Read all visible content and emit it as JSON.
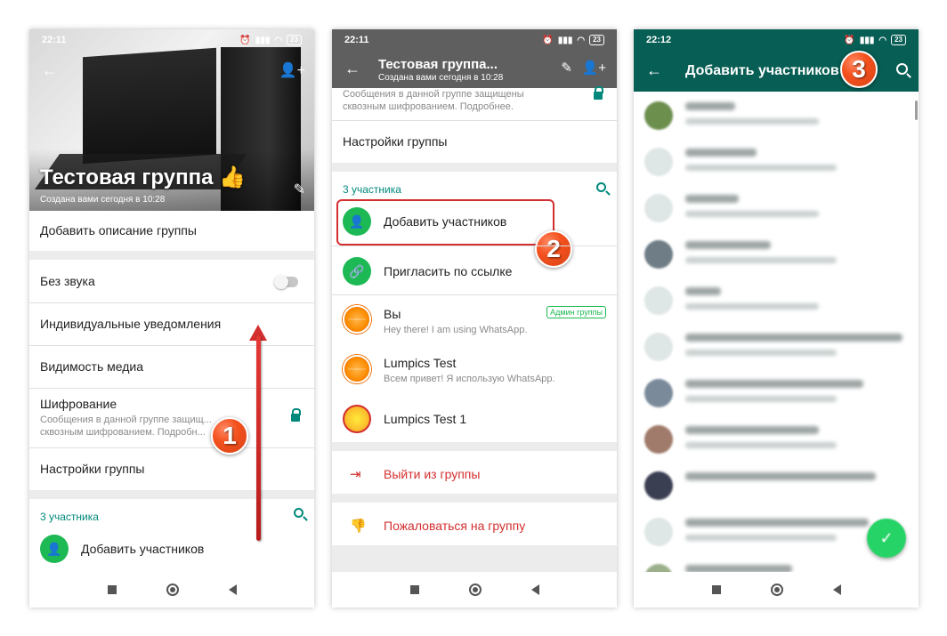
{
  "colors": {
    "accent_green": "#075e54",
    "wa_green": "#1db954",
    "teal": "#00897b",
    "red": "#d32f2f",
    "appbar_grey": "#5f5f5f"
  },
  "panel1": {
    "status": {
      "time": "22:11",
      "battery": "23"
    },
    "hero": {
      "title": "Тестовая группа 👍",
      "subtitle": "Создана вами сегодня в 10:28"
    },
    "rows": {
      "add_description": "Добавить описание группы",
      "mute": "Без звука",
      "custom_notifications": "Индивидуальные уведомления",
      "media_visibility": "Видимость медиа",
      "encryption": "Шифрование",
      "encryption_desc": "Сообщения в данной группе защищ... сквозным шифрованием. Подробн...",
      "group_settings": "Настройки группы"
    },
    "section_title": "3 участника",
    "add_participants": "Добавить участников",
    "badge": "1"
  },
  "panel2": {
    "status": {
      "time": "22:11",
      "battery": "23"
    },
    "appbar": {
      "title": "Тестовая группа...",
      "subtitle": "Создана вами сегодня в 10:28"
    },
    "encryption_desc": "Сообщения в данной группе защищены сквозным шифрованием. Подробнее.",
    "group_settings": "Настройки группы",
    "section_title": "3 участника",
    "add_participants": "Добавить участников",
    "invite_link": "Пригласить по ссылке",
    "members": [
      {
        "name": "Вы",
        "status": "Hey there! I am using WhatsApp.",
        "badge": "Админ группы"
      },
      {
        "name": "Lumpics Test",
        "status": "Всем привет! Я использую WhatsApp."
      },
      {
        "name": "Lumpics Test 1",
        "status": ""
      }
    ],
    "exit_group": "Выйти из группы",
    "report_group": "Пожаловаться на группу",
    "badge": "2"
  },
  "panel3": {
    "status": {
      "time": "22:12",
      "battery": "23"
    },
    "appbar": {
      "title": "Добавить участников"
    },
    "badge": "3",
    "fab_icon": "check-icon"
  }
}
